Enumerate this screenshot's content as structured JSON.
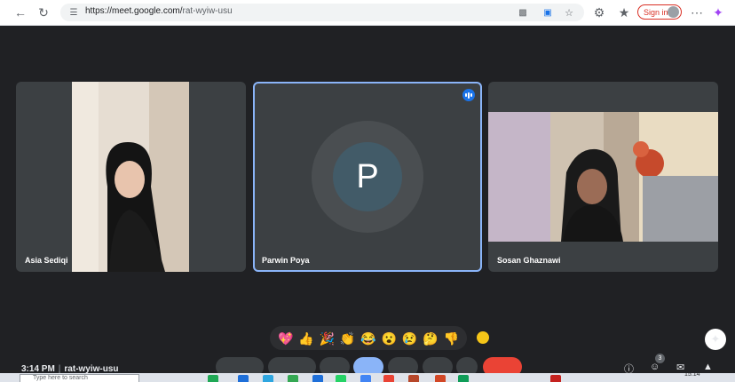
{
  "browser": {
    "url_host": "https://meet.google.com/",
    "url_path": "rat-wyiw-usu",
    "signin_label": "Sign in"
  },
  "participants": [
    {
      "name": "Asia Sediqi",
      "video": true
    },
    {
      "name": "Parwin Poya",
      "video": false,
      "initial": "P",
      "speaking": true,
      "avatar_color": "#425b68"
    },
    {
      "name": "Sosan Ghaznawi",
      "video": true
    }
  ],
  "reactions": [
    "💖",
    "👍",
    "🎉",
    "👏",
    "😂",
    "😮",
    "😢",
    "🤔",
    "👎"
  ],
  "meeting": {
    "time": "3:14 PM",
    "code": "rat-wyiw-usu",
    "participant_count": "3"
  },
  "taskbar": {
    "search_placeholder": "Type here to search",
    "clock": "15:14"
  },
  "colors": {
    "speaking_border": "#8ab4f8",
    "end_call": "#ea4335",
    "signin": "#d93025"
  }
}
